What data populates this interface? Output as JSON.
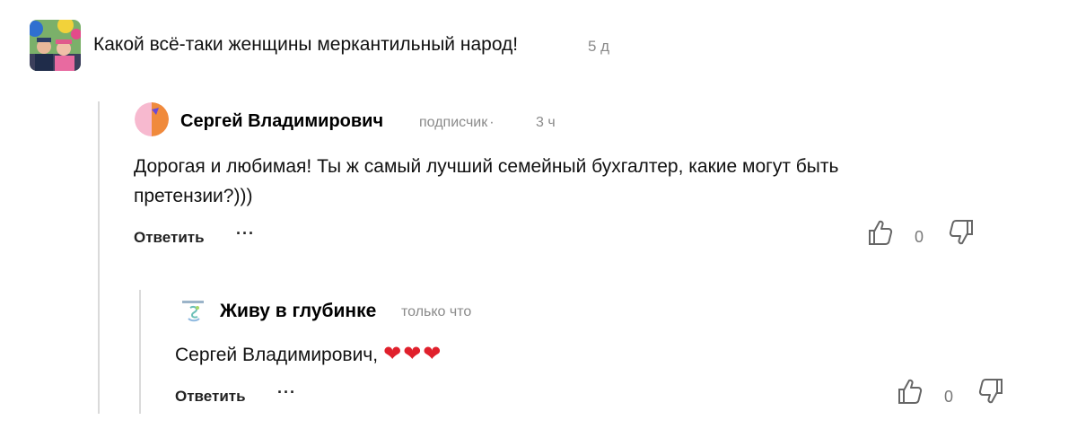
{
  "top_comment": {
    "text": "Какой всё-таки женщины меркантильный народ!",
    "time": "5 д"
  },
  "replies": [
    {
      "author": "Сергей Владимирович",
      "role": "подписчик",
      "separator": "·",
      "time": "3 ч",
      "text": "Дорогая и любимая! Ты ж самый лучший семейный бухгалтер, какие могут быть претензии?)))",
      "reply_label": "Ответить",
      "more_label": "···",
      "likes": "0"
    },
    {
      "author": "Живу в глубинке",
      "time": "только что",
      "text": "Сергей Владимирович,",
      "hearts": "❤❤❤",
      "reply_label": "Ответить",
      "more_label": "···",
      "likes": "0"
    }
  ],
  "colors": {
    "muted": "#8a8a8a",
    "thread_line": "#dadada",
    "heart": "#e0202c",
    "avatar_pink": "#f7b9cf",
    "avatar_orange": "#f08a3c"
  }
}
